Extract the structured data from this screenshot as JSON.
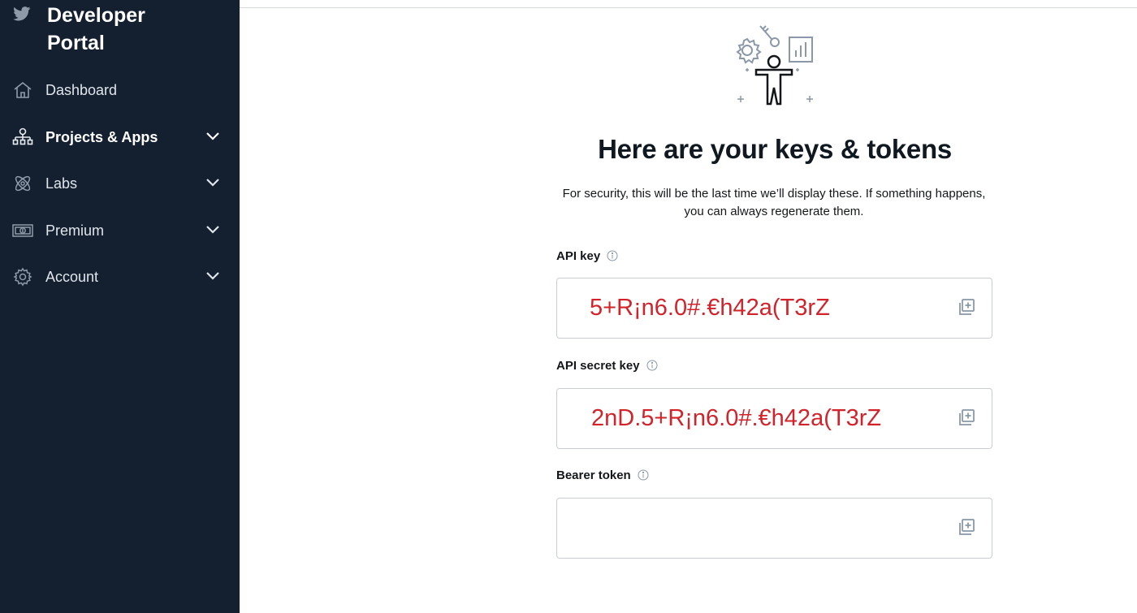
{
  "brand": {
    "title_line1": "Developer",
    "title_line2": "Portal",
    "icon": "twitter-bird-icon"
  },
  "sidebar": {
    "items": [
      {
        "label": "Dashboard",
        "icon": "home-icon",
        "active": false,
        "has_chevron": false
      },
      {
        "label": "Projects & Apps",
        "icon": "hierarchy-icon",
        "active": true,
        "has_chevron": true
      },
      {
        "label": "Labs",
        "icon": "labs-atom-icon",
        "active": false,
        "has_chevron": true
      },
      {
        "label": "Premium",
        "icon": "dollar-bill-icon",
        "active": false,
        "has_chevron": true
      },
      {
        "label": "Account",
        "icon": "gear-icon",
        "active": false,
        "has_chevron": true
      }
    ]
  },
  "main": {
    "heading": "Here are your keys & tokens",
    "subtext": "For security, this will be the last time we’ll display these. If something happens, you can always regenerate them.",
    "fields": [
      {
        "label": "API key",
        "value": "5+R¡n6.0#.€h42a(T3rZ"
      },
      {
        "label": "API secret key",
        "value": "2nD.5+R¡n6.0#.€h42a(T3rZ"
      },
      {
        "label": "Bearer token",
        "value": ""
      }
    ]
  },
  "colors": {
    "sidebar_bg": "#14202f",
    "redacted_text": "#d2232a",
    "icon_gray": "#8a98a8"
  }
}
